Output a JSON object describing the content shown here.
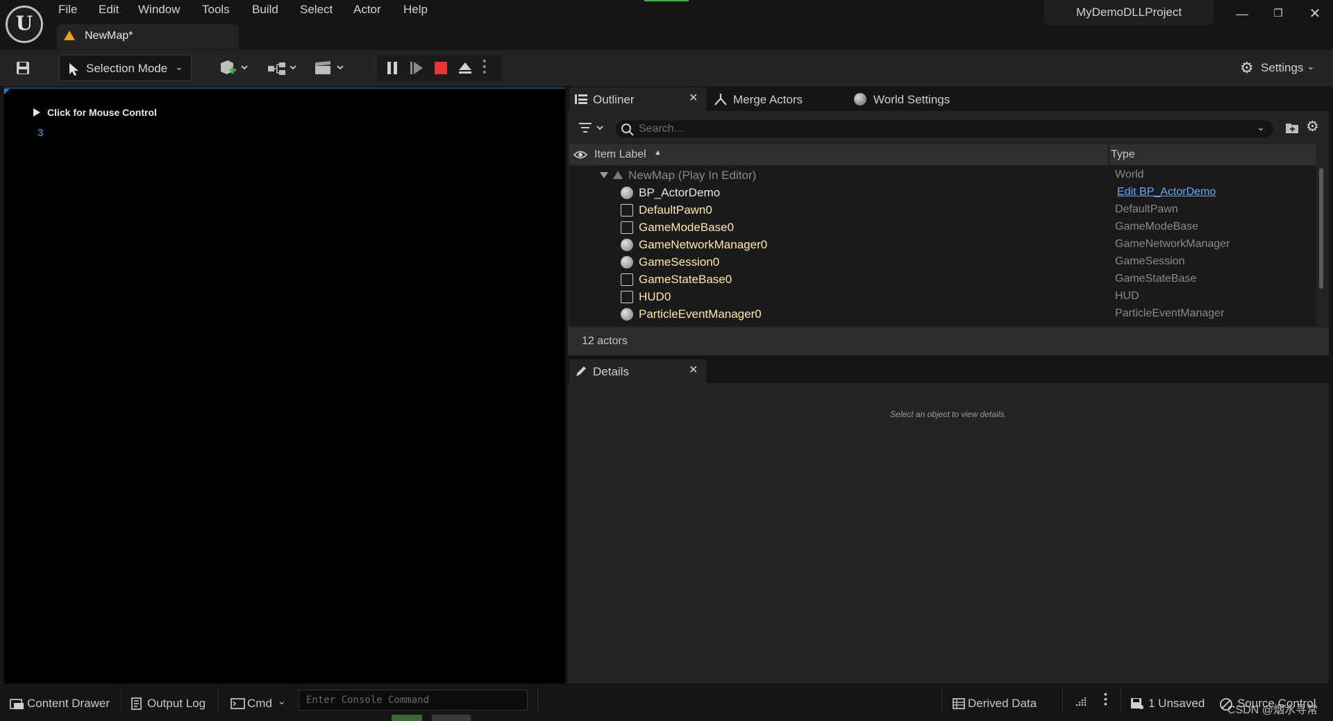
{
  "app": {
    "project_name": "MyDemoDLLProject",
    "map_tab": "NewMap*"
  },
  "menu": [
    "File",
    "Edit",
    "Window",
    "Tools",
    "Build",
    "Select",
    "Actor",
    "Help"
  ],
  "toolbar": {
    "selection_mode": "Selection Mode",
    "settings": "Settings"
  },
  "viewport": {
    "mouse_hint": "Click for Mouse Control",
    "number": "3"
  },
  "panel_tabs": {
    "outliner": "Outliner",
    "merge_actors": "Merge Actors",
    "world_settings": "World Settings",
    "details": "Details"
  },
  "outliner": {
    "search_placeholder": "Search...",
    "col_label": "Item Label",
    "col_type": "Type",
    "world": {
      "label": "NewMap (Play In Editor)",
      "type": "World"
    },
    "rows": [
      {
        "label": "BP_ActorDemo",
        "type": "Edit BP_ActorDemo",
        "icon": "actor-sphere-icon"
      },
      {
        "label": "DefaultPawn0",
        "type": "DefaultPawn",
        "icon": "pawn-icon"
      },
      {
        "label": "GameModeBase0",
        "type": "GameModeBase",
        "icon": "gamemode-icon"
      },
      {
        "label": "GameNetworkManager0",
        "type": "GameNetworkManager",
        "icon": "actor-sphere-icon"
      },
      {
        "label": "GameSession0",
        "type": "GameSession",
        "icon": "actor-sphere-icon"
      },
      {
        "label": "GameStateBase0",
        "type": "GameStateBase",
        "icon": "gamestate-icon"
      },
      {
        "label": "HUD0",
        "type": "HUD",
        "icon": "hud-icon"
      },
      {
        "label": "ParticleEventManager0",
        "type": "ParticleEventManager",
        "icon": "actor-sphere-icon"
      }
    ],
    "actors_count": "12 actors"
  },
  "details": {
    "empty_hint": "Select an object to view details."
  },
  "statusbar": {
    "content_drawer": "Content Drawer",
    "output_log": "Output Log",
    "cmd": "Cmd",
    "console_placeholder": "Enter Console Command",
    "derived_data": "Derived Data",
    "unsaved": "1 Unsaved",
    "source_control": "Source Control",
    "watermark": "CSDN @烟水寻常"
  },
  "colors": {
    "accent_blue": "#2f7ad8",
    "actor_label": "#ffe8a8",
    "link": "#6aa7ff",
    "stop_red": "#e53935"
  }
}
